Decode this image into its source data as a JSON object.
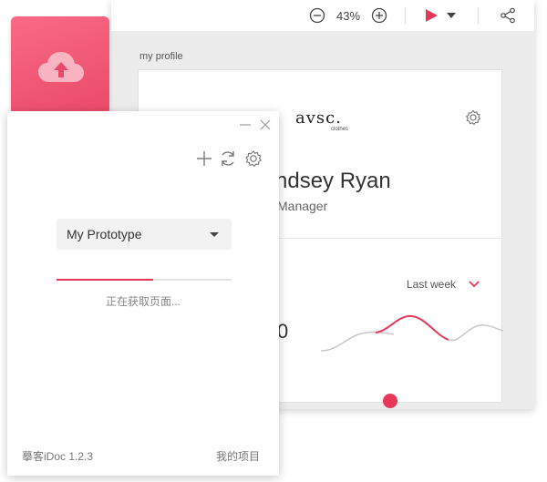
{
  "preview": {
    "zoom": "43%",
    "page_label": "my profile",
    "card": {
      "logo": "avsc.",
      "logo_sub": "clothes",
      "name": "ndsey Ryan",
      "role": "Manager",
      "period": "Last week",
      "stat": "0"
    }
  },
  "plugin": {
    "project_select": {
      "value": "My Prototype"
    },
    "progress": 0.55,
    "status": "正在获取页面...",
    "version": "摹客iDoc 1.2.3",
    "my_projects": "我的项目"
  },
  "colors": {
    "accent": "#e8385a",
    "tile_gradient_start": "#f86a86",
    "tile_gradient_end": "#ea4a68"
  },
  "icons": {
    "toolbar": [
      "zoom-out-icon",
      "zoom-in-icon",
      "play-icon",
      "chevron-down-icon",
      "share-icon"
    ],
    "plugin": [
      "minimize-icon",
      "close-icon",
      "add-icon",
      "refresh-icon",
      "gear-icon",
      "cloud-upload-icon"
    ]
  }
}
